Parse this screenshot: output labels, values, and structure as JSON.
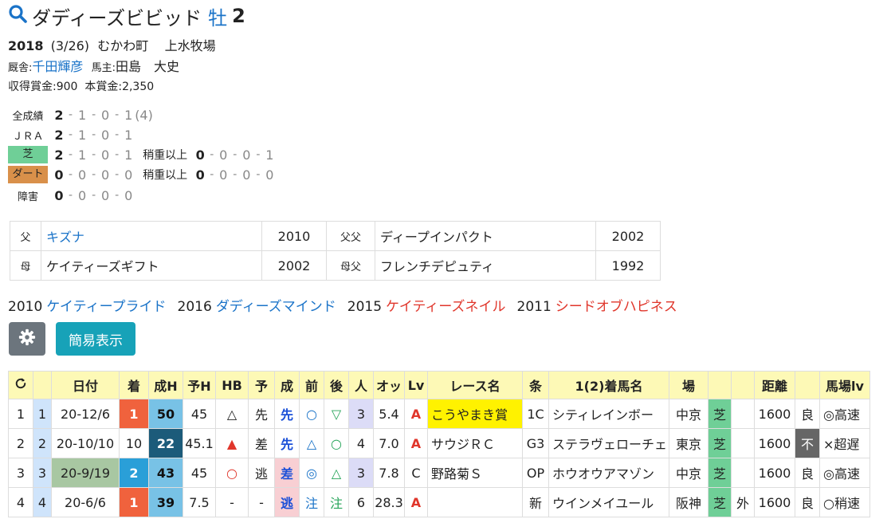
{
  "horse": {
    "name": "ダディーズビビッド",
    "sex": "牡",
    "age": "2",
    "birth_year": "2018",
    "birth_date": "(3/26)",
    "birth_place": "むかわ町",
    "breeder": "上水牧場",
    "trainer_label": "厩舎:",
    "trainer": "千田輝彦",
    "owner_label": "馬主:",
    "owner": "田島　大史",
    "prize_label": "収得賞金:",
    "prize": "900",
    "main_prize_label": "本賞金:",
    "main_prize": "2,350"
  },
  "records": [
    {
      "label": "全成績",
      "style": "plain",
      "values": [
        "2",
        "1",
        "0",
        "1"
      ],
      "extra": "(4)"
    },
    {
      "label": "ＪＲＡ",
      "style": "plain",
      "values": [
        "2",
        "1",
        "0",
        "1"
      ],
      "extra": ""
    },
    {
      "label": "芝",
      "style": "turf",
      "values": [
        "2",
        "1",
        "0",
        "1"
      ],
      "extra": "",
      "heavy_label": "稍重以上",
      "heavy": [
        "0",
        "0",
        "0",
        "1"
      ]
    },
    {
      "label": "ダート",
      "style": "dirt",
      "values": [
        "0",
        "0",
        "0",
        "0"
      ],
      "extra": "",
      "heavy_label": "稍重以上",
      "heavy": [
        "0",
        "0",
        "0",
        "0"
      ]
    },
    {
      "label": "障害",
      "style": "plain",
      "values": [
        "0",
        "0",
        "0",
        "0"
      ],
      "extra": ""
    }
  ],
  "pedigree": {
    "sire_label": "父",
    "sire": "キズナ",
    "sire_year": "2010",
    "sire_sire_label": "父父",
    "sire_sire": "ディープインパクト",
    "sire_sire_year": "2002",
    "dam_label": "母",
    "dam": "ケイティーズギフト",
    "dam_year": "2002",
    "dam_sire_label": "母父",
    "dam_sire": "フレンチデピュティ",
    "dam_sire_year": "1992"
  },
  "siblings": [
    {
      "year": "2010",
      "name": "ケイティープライド",
      "color": "blue"
    },
    {
      "year": "2016",
      "name": "ダディーズマインド",
      "color": "blue"
    },
    {
      "year": "2015",
      "name": "ケイティーズネイル",
      "color": "red"
    },
    {
      "year": "2011",
      "name": "シードオブハピネス",
      "color": "red"
    }
  ],
  "buttons": {
    "settings_icon": "gear-icon",
    "simple_view": "簡易表示"
  },
  "table": {
    "headers": [
      "",
      "",
      "日付",
      "着",
      "成H",
      "予H",
      "HB",
      "予",
      "成",
      "前",
      "後",
      "人",
      "オッ",
      "Lv",
      "レース名",
      "条",
      "1(2)着馬名",
      "場",
      "",
      "",
      "距離",
      "",
      "馬場lv"
    ],
    "rows": [
      [
        "1",
        "1",
        "20-12/6",
        "1",
        "50",
        "45",
        "△",
        "先",
        "先",
        "○",
        "▽",
        "3",
        "5.4",
        "A",
        "こうやまき賞",
        "1C",
        "シティレインボー",
        "中京",
        "芝",
        "",
        "1600",
        "良",
        "◎高速"
      ],
      [
        "2",
        "2",
        "20-10/10",
        "10",
        "22",
        "45.1",
        "▲",
        "差",
        "先",
        "△",
        "○",
        "4",
        "7.0",
        "A",
        "サウジＲＣ",
        "G3",
        "ステラヴェローチェ",
        "東京",
        "芝",
        "",
        "1600",
        "不",
        "×超遅"
      ],
      [
        "3",
        "3",
        "20-9/19",
        "2",
        "43",
        "45",
        "○",
        "逃",
        "差",
        "◎",
        "△",
        "3",
        "7.8",
        "C",
        "野路菊Ｓ",
        "OP",
        "ホウオウアマゾン",
        "中京",
        "芝",
        "",
        "1600",
        "良",
        "◎高速"
      ],
      [
        "4",
        "4",
        "20-6/6",
        "1",
        "39",
        "7.5",
        "-",
        "-",
        "逃",
        "注",
        "注",
        "6",
        "28.3",
        "A",
        "",
        "新",
        "ウインメイユール",
        "阪神",
        "芝",
        "外",
        "1600",
        "良",
        "○稍速"
      ]
    ]
  }
}
